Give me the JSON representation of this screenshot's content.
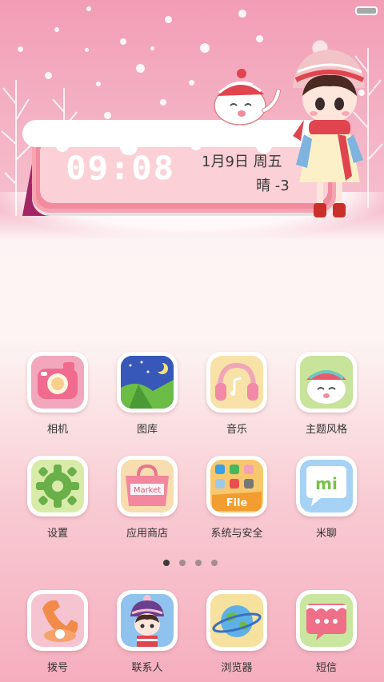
{
  "status_bar": {
    "battery_icon": "battery-icon"
  },
  "lock_widget": {
    "time": "09:08",
    "date": "1月9日 周五",
    "weather": "晴 -3"
  },
  "apps": [
    {
      "label": "相机",
      "icon": "camera-icon",
      "color": "#f3a7bd"
    },
    {
      "label": "图库",
      "icon": "gallery-icon",
      "color": "#6aa9e6"
    },
    {
      "label": "音乐",
      "icon": "headphones-icon",
      "color": "#f8e2a8"
    },
    {
      "label": "主题风格",
      "icon": "theme-cat-icon",
      "color": "#c8e39a"
    },
    {
      "label": "设置",
      "icon": "gear-icon",
      "color": "#d8eba8"
    },
    {
      "label": "应用商店",
      "icon": "shopping-bag-icon",
      "color": "#f8ddb0"
    },
    {
      "label": "系统与安全",
      "icon": "file-manager-icon",
      "color": "#f7c86e"
    },
    {
      "label": "米聊",
      "icon": "chat-bubble-icon",
      "color": "#a6d2f5"
    }
  ],
  "page_indicator": {
    "count": 4,
    "active_index": 0
  },
  "dock": [
    {
      "label": "拨号",
      "icon": "phone-icon",
      "color": "#f6c4d0"
    },
    {
      "label": "联系人",
      "icon": "contacts-icon",
      "color": "#8fc3ee"
    },
    {
      "label": "浏览器",
      "icon": "globe-icon",
      "color": "#f6e29e"
    },
    {
      "label": "短信",
      "icon": "message-icon",
      "color": "#c9e79e"
    }
  ]
}
